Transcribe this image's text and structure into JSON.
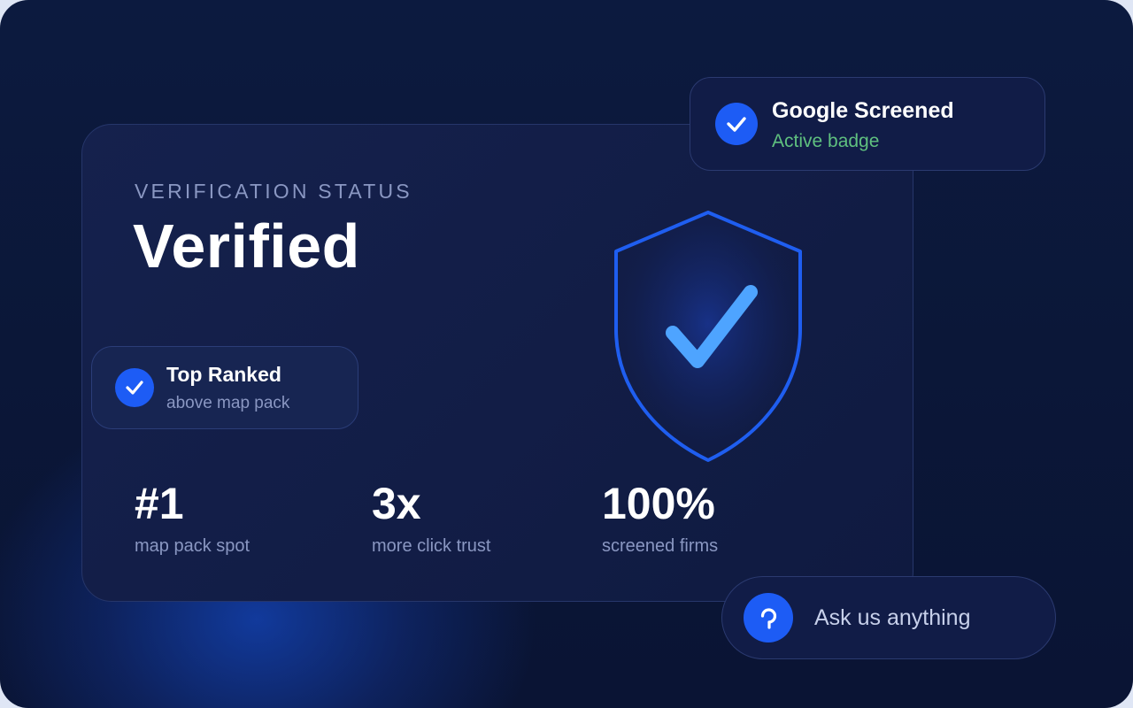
{
  "card": {
    "eyebrow": "VERIFICATION STATUS",
    "title": "Verified"
  },
  "badges": {
    "top_ranked": {
      "title": "Top Ranked",
      "subtitle": "above map pack"
    },
    "google": {
      "title": "Google Screened",
      "subtitle": "Active badge"
    }
  },
  "stats": [
    {
      "value": "#1",
      "label": "map pack spot"
    },
    {
      "value": "3x",
      "label": "more click trust"
    },
    {
      "value": "100%",
      "label": "screened firms"
    }
  ],
  "chat": {
    "label": "Ask us anything"
  },
  "icons": {
    "shield": "shield-check-icon",
    "check": "check-icon",
    "chat": "chat-bubble-icon"
  },
  "colors": {
    "accent": "#1d5cf5",
    "shield_stroke": "#1f5ef0",
    "check_light": "#4ea4ff",
    "success": "#5fc07f",
    "muted": "#8a97c2"
  }
}
